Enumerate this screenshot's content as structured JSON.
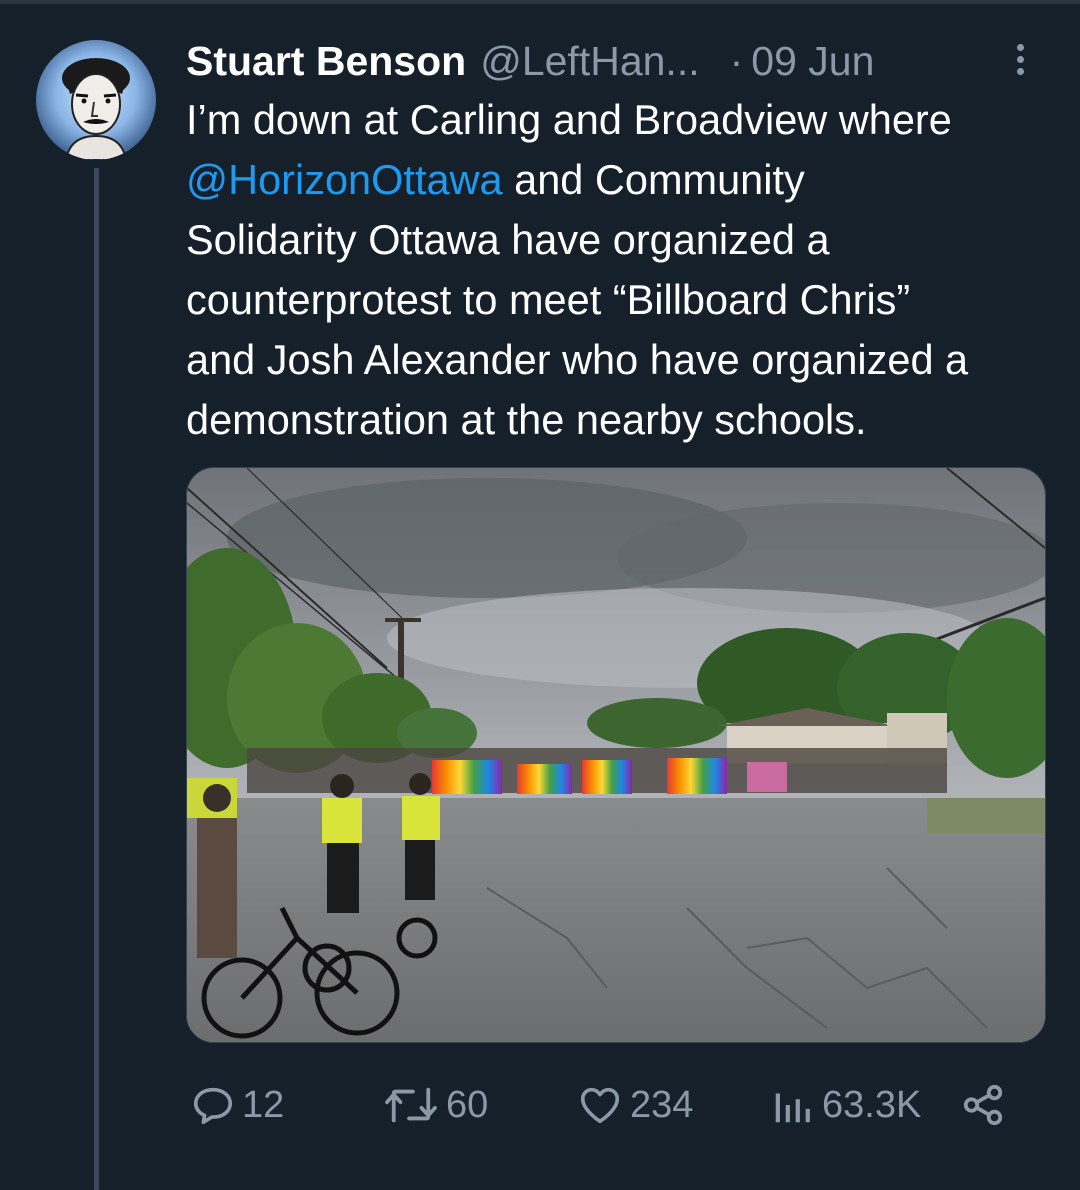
{
  "tweet": {
    "author_name": "Stuart Benson",
    "handle": "@LeftHan...",
    "separator": "·",
    "date": "09 Jun",
    "text_line_1": "I’m down at Carling and Broadview where",
    "mention": "@HorizonOttawa",
    "text_after_mention": " and Community",
    "text_line_3": "Solidarity Ottawa have organized a",
    "text_line_4": "counterprotest to meet “Billboard Chris”",
    "text_line_5": "and Josh Alexander who have organized a",
    "text_line_6": "demonstration at the nearby schools."
  },
  "stats": {
    "replies": "12",
    "reposts": "60",
    "likes": "234",
    "views": "63.3K"
  },
  "icons": {
    "reply": "reply-icon",
    "repost": "repost-icon",
    "like": "heart-icon",
    "views": "views-icon",
    "share": "share-icon",
    "more": "more-icon"
  },
  "colors": {
    "background": "#15202b",
    "text": "#ffffff",
    "secondary": "#8b98a5",
    "link": "#1d9bf0"
  }
}
